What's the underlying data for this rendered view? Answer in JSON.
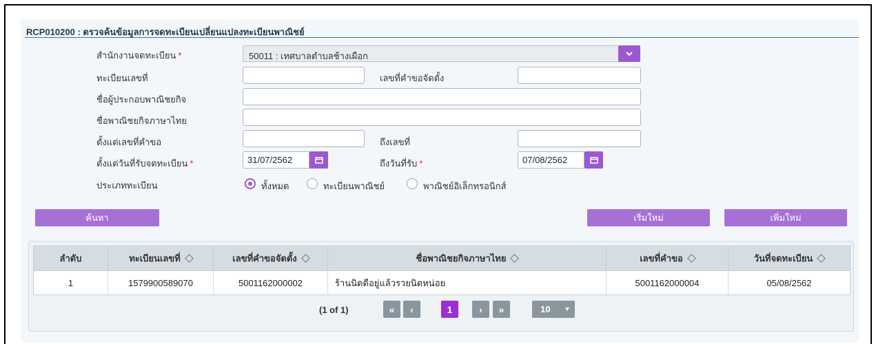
{
  "page": {
    "title": "RCP010200 : ตรวจค้นข้อมูลการจดทะเบียนเปลี่ยนแปลงทะเบียนพาณิชย์"
  },
  "form": {
    "office_label": "สำนักงานจดทะเบียน",
    "office_value": "50011 : เทศบาลตำบลช้างเผือก",
    "reg_no_label": "ทะเบียนเลขที่",
    "reg_no_value": "",
    "request_no_label": "เลขที่คำขอจัดตั้ง",
    "request_no_value": "",
    "operator_label": "ชื่อผู้ประกอบพาณิชยกิจ",
    "operator_value": "",
    "business_name_label": "ชื่อพาณิชยกิจภาษาไทย",
    "business_name_value": "",
    "from_req_label": "ตั้งแต่เลขที่คำขอ",
    "from_req_value": "",
    "to_req_label": "ถึงเลขที่",
    "to_req_value": "",
    "from_date_label": "ตั้งแต่วันที่รับจดทะเบียน",
    "from_date_value": "31/07/2562",
    "to_date_label": "ถึงวันที่รับ",
    "to_date_value": "07/08/2562",
    "type_label": "ประเภททะเบียน",
    "type_options": [
      "ทั้งหมด",
      "ทะเบียนพาณิชย์",
      "พาณิชย์อิเล็กทรอนิกส์"
    ],
    "type_selected": "ทั้งหมด",
    "required_mark": "*"
  },
  "buttons": {
    "search": "ค้นหา",
    "reset": "เริ่มใหม่",
    "add": "เพิ่มใหม่"
  },
  "table": {
    "columns": [
      "ลำดับ",
      "ทะเบียนเลขที่",
      "เลขที่คำขอจัดตั้ง",
      "ชื่อพาณิชยกิจภาษาไทย",
      "เลขที่คำขอ",
      "วันที่จดทะเบียน"
    ],
    "rows": [
      [
        "1",
        "1579900589070",
        "5001162000002",
        "ร้านนิดดีอยู่แล้วรวยนิดหน่อย",
        "5001162000004",
        "05/08/2562"
      ]
    ]
  },
  "pager": {
    "status": "(1 of 1)",
    "first": "«",
    "prev": "‹",
    "current": "1",
    "next": "›",
    "last": "»",
    "page_size": "10"
  },
  "colors": {
    "accent": "#9b59d0",
    "button": "#a770d6"
  }
}
